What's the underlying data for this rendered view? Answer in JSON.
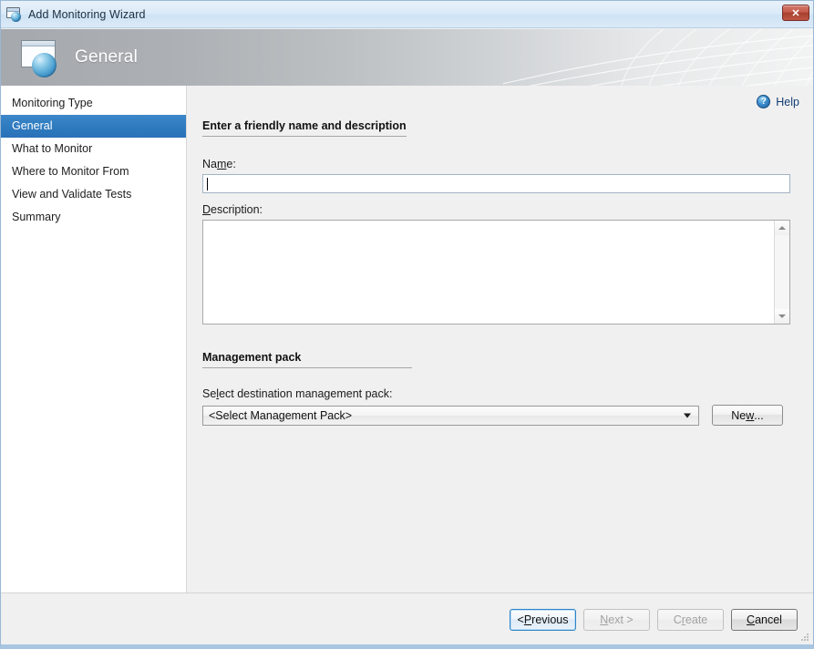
{
  "window": {
    "title": "Add Monitoring Wizard",
    "title_icon": "monitoring-window-icon",
    "close_label": "✕"
  },
  "banner": {
    "title": "General",
    "icon": "monitoring-window-globe-icon"
  },
  "sidebar": {
    "items": [
      {
        "label": "Monitoring Type",
        "selected": false
      },
      {
        "label": "General",
        "selected": true
      },
      {
        "label": "What to Monitor",
        "selected": false
      },
      {
        "label": "Where to Monitor From",
        "selected": false
      },
      {
        "label": "View and Validate Tests",
        "selected": false
      },
      {
        "label": "Summary",
        "selected": false
      }
    ]
  },
  "content": {
    "help": {
      "label": "Help",
      "icon": "help-question-icon"
    },
    "section_general": {
      "heading": "Enter a friendly name and description",
      "name_label_pre": "Na",
      "name_label_acc": "m",
      "name_label_post": "e:",
      "name_value": "",
      "description_label_acc": "D",
      "description_label_post": "escription:",
      "description_value": ""
    },
    "section_mp": {
      "heading": "Management pack",
      "select_label_pre": "Se",
      "select_label_acc": "l",
      "select_label_post": "ect destination management pack:",
      "combo_value": "<Select Management Pack>",
      "new_button_pre": "Ne",
      "new_button_acc": "w",
      "new_button_post": "..."
    }
  },
  "footer": {
    "buttons": [
      {
        "pre": "< ",
        "acc": "P",
        "post": "revious",
        "state": "focused"
      },
      {
        "pre": "",
        "acc": "N",
        "post": "ext >",
        "state": "disabled"
      },
      {
        "pre": "C",
        "acc": "r",
        "post": "eate",
        "state": "disabled"
      },
      {
        "pre": "",
        "acc": "C",
        "post": "ancel",
        "state": "enabled"
      }
    ]
  },
  "colors": {
    "accent_selection": "#2f7bc0",
    "banner_left": "#a5a9ad",
    "banner_right": "#f2f3f3",
    "content_bg": "#f0f0f0",
    "close_button": "#bd5645",
    "help_link": "#123c74"
  }
}
